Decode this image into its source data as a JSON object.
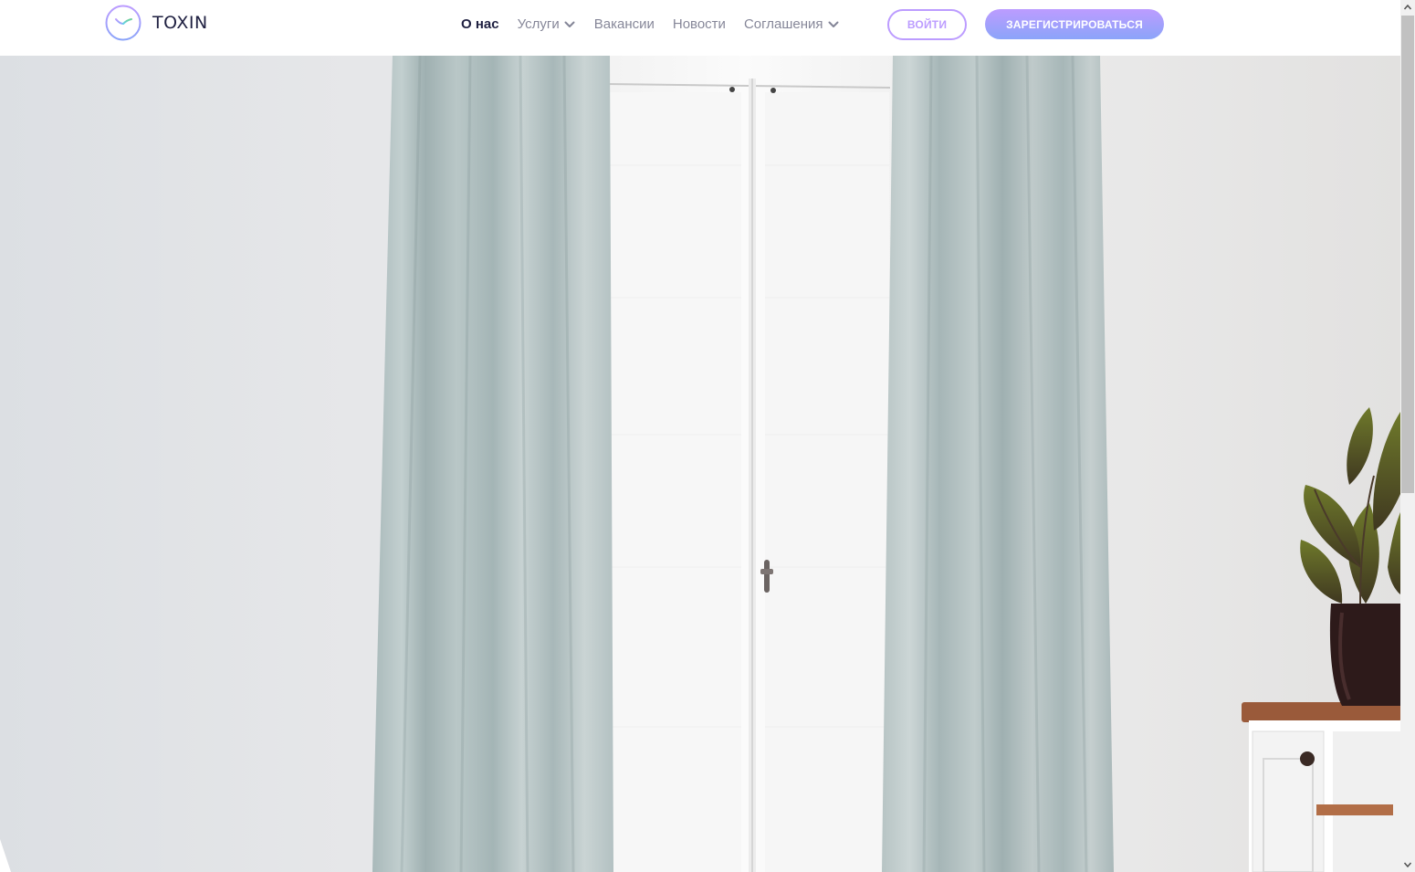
{
  "brand": {
    "name": "TOXIN",
    "accent_color": "#bc9cff",
    "accent_gradient_end": "#8ba4f9",
    "text_color": "#1f2041"
  },
  "nav": {
    "items": [
      {
        "label": "О нас",
        "active": true,
        "has_dropdown": false
      },
      {
        "label": "Услуги",
        "active": false,
        "has_dropdown": true
      },
      {
        "label": "Вакансии",
        "active": false,
        "has_dropdown": false
      },
      {
        "label": "Новости",
        "active": false,
        "has_dropdown": false
      },
      {
        "label": "Соглашения",
        "active": false,
        "has_dropdown": true
      }
    ],
    "dropdown_icon": "chevron-down-icon"
  },
  "auth": {
    "login_label": "ВОЙТИ",
    "register_label": "ЗАРЕГИСТРИРОВАТЬСЯ"
  },
  "hero": {
    "image": "room with grey-blue curtains, bright window, and potted rubber plant on a white wooden cabinet"
  }
}
